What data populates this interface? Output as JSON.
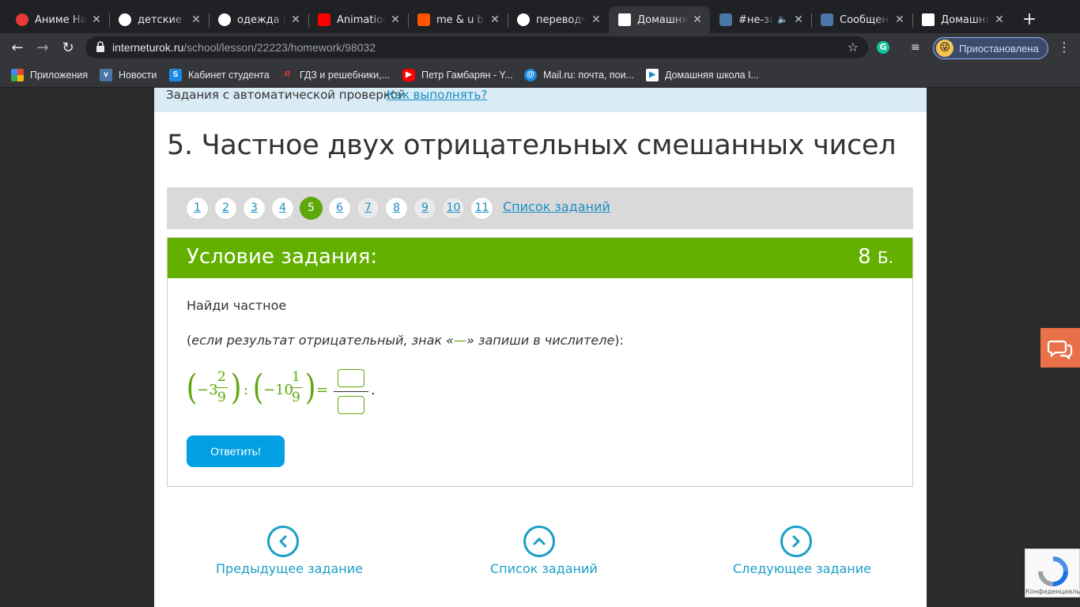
{
  "tabs": [
    {
      "title": "Аниме Наз",
      "favicon_color": "#e53935",
      "favicon": "opera-icon"
    },
    {
      "title": "детские пр",
      "favicon_color": "#ffffff",
      "favicon": "google-icon"
    },
    {
      "title": "одежда ре",
      "favicon_color": "#ffffff",
      "favicon": "google-icon"
    },
    {
      "title": "Animation p",
      "favicon_color": "#ff0000",
      "favicon": "youtube-icon"
    },
    {
      "title": "me & u by s",
      "favicon_color": "#ff5500",
      "favicon": "soundcloud-icon"
    },
    {
      "title": "переводчи",
      "favicon_color": "#ffffff",
      "favicon": "google-icon"
    },
    {
      "title": "Домашняя",
      "favicon_color": "#ffffff",
      "favicon": "interneturok-icon"
    },
    {
      "title": "#не-за",
      "favicon_color": "#4a76a8",
      "favicon": "vk-icon"
    },
    {
      "title": "Сообщени",
      "favicon_color": "#4a76a8",
      "favicon": "vk-icon"
    },
    {
      "title": "Домашняя",
      "favicon_color": "#ffffff",
      "favicon": "interneturok-icon"
    }
  ],
  "address_bar": {
    "host": "interneturok.ru",
    "path": "/school/lesson/22223/homework/98032"
  },
  "profile": {
    "label": "Приостановлена"
  },
  "bookmarks": [
    {
      "label": "Приложения",
      "icon": "apps-icon",
      "color": "#4285f4"
    },
    {
      "label": "Новости",
      "icon": "vk-icon",
      "color": "#4a76a8"
    },
    {
      "label": "Кабинет студента",
      "icon": "s-icon",
      "color": "#1e88e5"
    },
    {
      "label": "ГДЗ и решебники,...",
      "icon": "gdz-icon",
      "color": "#e53935"
    },
    {
      "label": "Петр Гамбарян - Y...",
      "icon": "youtube-icon",
      "color": "#ff0000"
    },
    {
      "label": "Mail.ru: почта, пои...",
      "icon": "mail-icon",
      "color": "#168de2"
    },
    {
      "label": "Домашняя школа I...",
      "icon": "interneturok-icon",
      "color": "#ffffff"
    }
  ],
  "page": {
    "autocheck_text": "Задания с автоматической проверкой",
    "how_to_link": "Как выполнять?",
    "title": "5. Частное двух отрицательных смешанных чисел",
    "pager": [
      "1",
      "2",
      "3",
      "4",
      "5",
      "6",
      "7",
      "8",
      "9",
      "10",
      "11"
    ],
    "pager_active": "5",
    "pager_list_link": "Список заданий",
    "task_header": "Условие задания:",
    "points_value": "8",
    "points_unit": "Б.",
    "question_line1": "Найди частное",
    "question_line2_open": "(",
    "question_line2_italic1": "если результат отрицательный, знак «",
    "question_line2_dash": "—",
    "question_line2_italic2": "» запиши в числителе",
    "question_line2_close": "):",
    "formula": {
      "first_whole": "−3",
      "first_num": "2",
      "first_den": "9",
      "op": ":",
      "second_whole": "−10",
      "second_num": "1",
      "second_den": "9",
      "eq": "=",
      "period": "."
    },
    "answer_button": "Ответить!",
    "prev_link": "Предыдущее задание",
    "list_link": "Список заданий",
    "next_link": "Следующее задание",
    "recaptcha_text": "Конфиденциально"
  }
}
